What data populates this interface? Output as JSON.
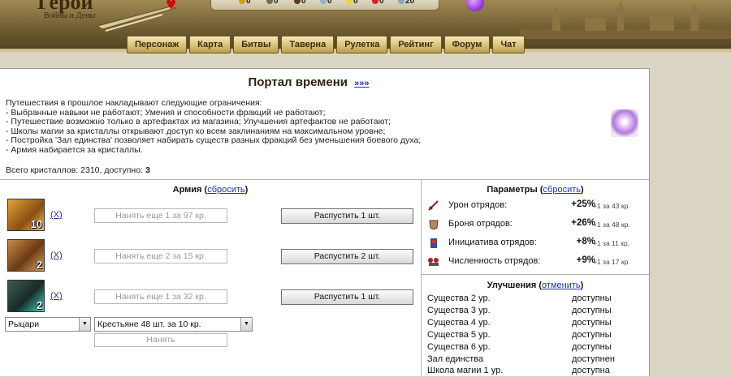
{
  "header": {
    "logo_title": "Герой",
    "logo_subtitle": "Войны и Деньг",
    "resources": [
      "0",
      "0",
      "0",
      "0",
      "0",
      "0",
      "20"
    ],
    "resource_colors": [
      "#d49a1a",
      "#7a6a55",
      "#5b3b25",
      "#9ab0c8",
      "#f2d23a",
      "#d4202a",
      "#8aa4c0"
    ],
    "nav": [
      "Персонаж",
      "Карта",
      "Битвы",
      "Таверна",
      "Рулетка",
      "Рейтинг",
      "Форум",
      "Чат"
    ]
  },
  "portal": {
    "title": "Портал времени",
    "title_link": "»»»",
    "intro": "Путешествия в прошлое накладывают следующие ограничения:",
    "rules": [
      "- Выбранные навыки не работают; Умения и способности фракций не работают;",
      "- Путешествие возможно только в артефактах из магазина; Улучшения артефактов не работают;",
      "- Школы магии за кристаллы открывают доступ ко всем заклинаниям на максимальном уровне;",
      "- Постройка 'Зал единства' позволяет набирать существ разных фракций без уменьшения боевого духа;",
      "- Армия набирается за кристаллы."
    ],
    "crystals_label": "Всего кристаллов: 2310, доступно:",
    "crystals_available": "3"
  },
  "army": {
    "title": "Армия",
    "reset_link": "сбросить",
    "units": [
      {
        "count": "10",
        "remove_link": "(X)",
        "hire_label": "Нанять еще 1 за 97 кр.",
        "dismiss_label": "Распустить 1 шт.",
        "portrait": "bull-warrior"
      },
      {
        "count": "2",
        "remove_link": "(X)",
        "hire_label": "Нанять еще 2 за 15 кр.",
        "dismiss_label": "Распустить 2 шт.",
        "portrait": "brown-beast"
      },
      {
        "count": "2",
        "remove_link": "(X)",
        "hire_label": "Нанять еще 1 за 32 кр.",
        "dismiss_label": "Распустить 1 шт.",
        "portrait": "cyan-golem"
      }
    ],
    "faction_select": "Рыцари",
    "unit_select": "Крестьяне 48 шт. за 10 кр.",
    "hire_button": "Нанять"
  },
  "params": {
    "title": "Параметры",
    "reset_link": "сбросить",
    "items": [
      {
        "label": "Урон отрядов:",
        "value": "+25%",
        "cost": "+1 за 43 кр.",
        "icon": "sword-icon"
      },
      {
        "label": "Броня отрядов:",
        "value": "+26%",
        "cost": "+1 за 48 кр.",
        "icon": "armor-icon"
      },
      {
        "label": "Инициатива отрядов:",
        "value": "+8%",
        "cost": "+1 за 11 кр.",
        "icon": "initiative-icon"
      },
      {
        "label": "Численность отрядов:",
        "value": "+9%",
        "cost": "+1 за 17 кр.",
        "icon": "squad-icon"
      }
    ]
  },
  "upgrades": {
    "title": "Улучшения",
    "cancel_link": "отменить",
    "items": [
      {
        "name": "Существа 2 ур.",
        "status": "доступны"
      },
      {
        "name": "Существа 3 ур.",
        "status": "доступны"
      },
      {
        "name": "Существа 4 ур.",
        "status": "доступны"
      },
      {
        "name": "Существа 5 ур.",
        "status": "доступны"
      },
      {
        "name": "Существа 6 ур.",
        "status": "доступны"
      },
      {
        "name": "Зал единства",
        "status": "доступнен"
      },
      {
        "name": "Школа магии 1 ур.",
        "status": "доступна"
      }
    ]
  }
}
